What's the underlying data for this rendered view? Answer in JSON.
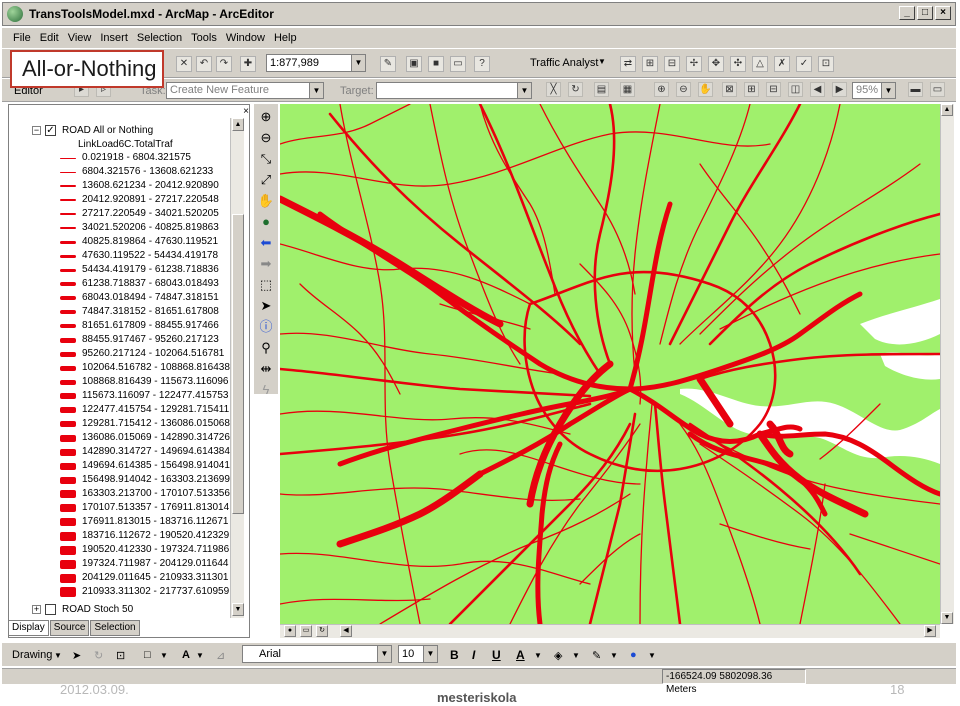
{
  "window": {
    "title": "TransToolsModel.mxd - ArcMap - ArcEditor",
    "controls": [
      "_",
      "□",
      "×"
    ]
  },
  "menu": [
    "File",
    "Edit",
    "View",
    "Insert",
    "Selection",
    "Tools",
    "Window",
    "Help"
  ],
  "callout": "All-or-Nothing",
  "standard_toolbar": {
    "scale": "1:877,989",
    "traffic_analyst": "Traffic Analyst"
  },
  "editor_toolbar": {
    "editor": "Editor",
    "task_label": "Task:",
    "task_value": "Create New Feature",
    "target_label": "Target:",
    "zoom_percent": "95%"
  },
  "toc": {
    "layer1": "ROAD All or Nothing",
    "field": "LinkLoad6C.TotalTraf",
    "legend": [
      "0.021918 - 6804.321575",
      "6804.321576 - 13608.621233",
      "13608.621234 - 20412.920890",
      "20412.920891 - 27217.220548",
      "27217.220549 - 34021.520205",
      "34021.520206 - 40825.819863",
      "40825.819864 - 47630.119521",
      "47630.119522 - 54434.419178",
      "54434.419179 - 61238.718836",
      "61238.718837 - 68043.018493",
      "68043.018494 - 74847.318151",
      "74847.318152 - 81651.617808",
      "81651.617809 - 88455.917466",
      "88455.917467 - 95260.217123",
      "95260.217124 - 102064.516781",
      "102064.516782 - 108868.816438",
      "108868.816439 - 115673.116096",
      "115673.116097 - 122477.415753",
      "122477.415754 - 129281.715411",
      "129281.715412 - 136086.015068",
      "136086.015069 - 142890.314726",
      "142890.314727 - 149694.614384",
      "149694.614385 - 156498.914041",
      "156498.914042 - 163303.213699",
      "163303.213700 - 170107.513356",
      "170107.513357 - 176911.813014",
      "176911.813015 - 183716.112671",
      "183716.112672 - 190520.412329",
      "190520.412330 - 197324.711986",
      "197324.711987 - 204129.011644",
      "204129.011645 - 210933.311301",
      "210933.311302 - 217737.610959"
    ],
    "layer2": "ROAD Stoch 50",
    "tabs": [
      "Display",
      "Source",
      "Selection"
    ]
  },
  "draw_toolbar": {
    "drawing": "Drawing",
    "font": "Arial",
    "size": "10",
    "bold": "B",
    "italic": "I",
    "underline": "U",
    "font_color_letter": "A"
  },
  "status": {
    "coords": "-166524.09  5802098.36 Meters"
  },
  "slide": {
    "date": "2012.03.09.",
    "brand": "mesteriskola",
    "page": "18"
  },
  "colors": {
    "land": "#a0f06c",
    "water": "#ffffff",
    "road": "#e8000e",
    "chrome": "#d4d0c8",
    "callout_border": "#c0392b"
  }
}
